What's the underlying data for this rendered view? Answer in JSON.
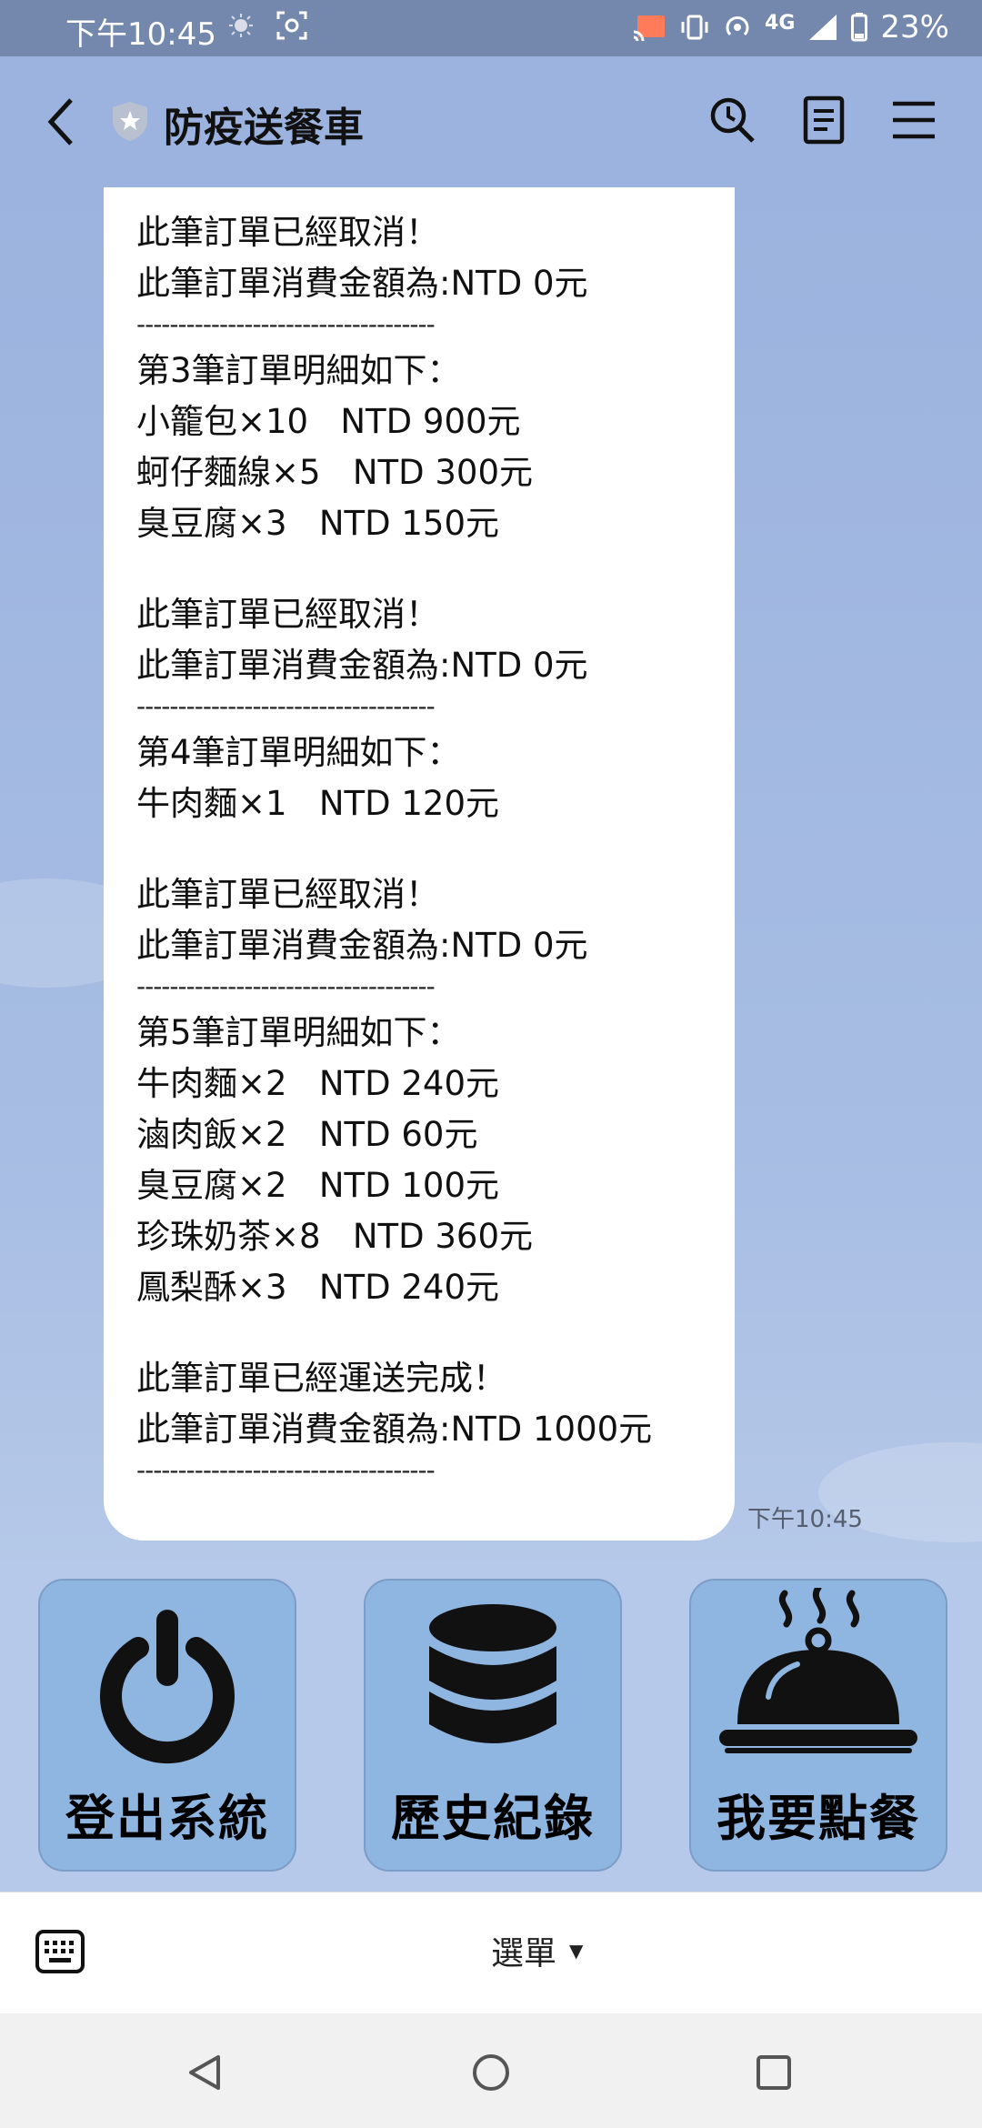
{
  "status_bar": {
    "time": "下午10:45",
    "network": "4G",
    "battery": "23%"
  },
  "header": {
    "title": "防疫送餐車"
  },
  "message": {
    "lines": [
      "此筆訂單已經取消！",
      "此筆訂單消費金額為:NTD 0元",
      "------------------------------------",
      "第3筆訂單明細如下：",
      "小籠包×10   NTD 900元",
      "蚵仔麵線×5   NTD 300元",
      "臭豆腐×3   NTD 150元",
      "",
      "此筆訂單已經取消！",
      "此筆訂單消費金額為:NTD 0元",
      "------------------------------------",
      "第4筆訂單明細如下：",
      "牛肉麵×1   NTD 120元",
      "",
      "此筆訂單已經取消！",
      "此筆訂單消費金額為:NTD 0元",
      "------------------------------------",
      "第5筆訂單明細如下：",
      "牛肉麵×2   NTD 240元",
      "滷肉飯×2   NTD 60元",
      "臭豆腐×2   NTD 100元",
      "珍珠奶茶×8   NTD 360元",
      "鳳梨酥×3   NTD 240元",
      "",
      "此筆訂單已經運送完成！",
      "此筆訂單消費金額為:NTD 1000元",
      "------------------------------------"
    ],
    "timestamp": "下午10:45"
  },
  "rich_menu": {
    "items": [
      {
        "label": "登出系統",
        "icon": "power-icon"
      },
      {
        "label": "歷史紀錄",
        "icon": "database-icon"
      },
      {
        "label": "我要點餐",
        "icon": "food-cloche-icon"
      }
    ]
  },
  "input_bar": {
    "menu_label": "選單"
  },
  "colors": {
    "chat_background": "#9cb3df",
    "status_bar": "#7488ad",
    "menu_card": "#8fb5e1"
  }
}
